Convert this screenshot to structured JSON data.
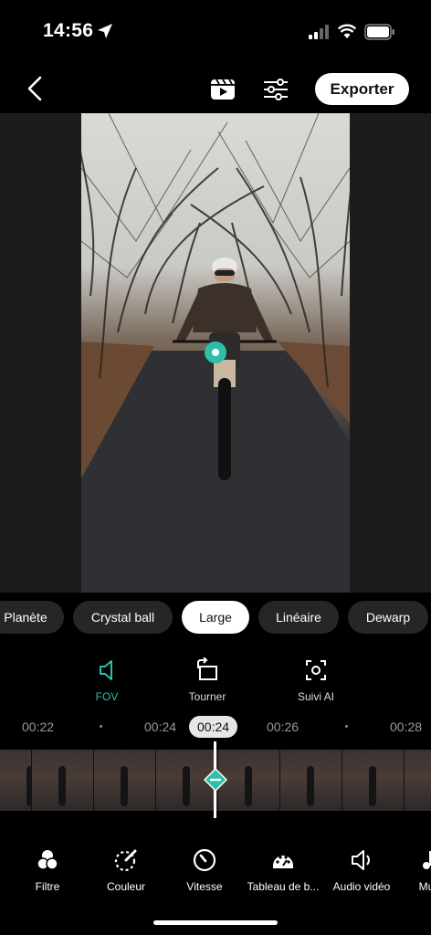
{
  "status_bar": {
    "time": "14:56"
  },
  "toolbar": {
    "export_label": "Exporter"
  },
  "lens_modes": [
    "Planète",
    "Crystal ball",
    "Large",
    "Linéaire",
    "Dewarp"
  ],
  "lens_selected": "Large",
  "tools": [
    {
      "label": "FOV",
      "icon": "speaker-fov-icon",
      "active": true
    },
    {
      "label": "Tourner",
      "icon": "rotate-icon",
      "active": false
    },
    {
      "label": "Suivi AI",
      "icon": "ai-tracking-icon",
      "active": false
    }
  ],
  "timeline": {
    "ticks": [
      "00:22",
      "00:24",
      "00:26",
      "00:28"
    ],
    "current_time": "00:24"
  },
  "bottom_bar": [
    {
      "label": "Filtre",
      "icon": "filter-icon"
    },
    {
      "label": "Couleur",
      "icon": "color-icon"
    },
    {
      "label": "Vitesse",
      "icon": "speed-icon"
    },
    {
      "label": "Tableau de b...",
      "icon": "dashboard-icon"
    },
    {
      "label": "Audio vidéo",
      "icon": "audio-icon"
    },
    {
      "label": "Mu",
      "icon": "music-icon"
    }
  ],
  "colors": {
    "accent": "#2fbfa8",
    "chip_bg": "#262626",
    "background": "#000000"
  }
}
